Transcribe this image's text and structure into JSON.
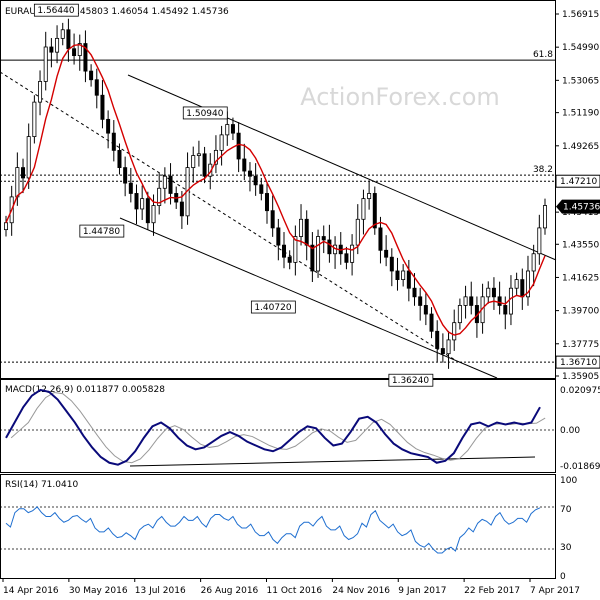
{
  "chart_data": [
    {
      "type": "candlestick",
      "title": "EURAUD,Daily  1.45803 1.46054 1.45492 1.45736",
      "watermark": "ActionForex.com",
      "y_ticks": [
        "1.56915",
        "1.54990",
        "1.53065",
        "1.51190",
        "1.49265",
        "1.47340",
        "1.45415",
        "1.43550",
        "1.41625",
        "1.39700",
        "1.37775",
        "1.35905"
      ],
      "ylim": [
        1.35905,
        1.56915
      ],
      "x_ticks": [
        "14 Apr 2016",
        "30 May 2016",
        "13 Jul 2016",
        "26 Aug 2016",
        "11 Oct 2016",
        "24 Nov 2016",
        "9 Jan 2017",
        "22 Feb 2017",
        "7 Apr 2017"
      ],
      "current_price_label": "1.45736",
      "current_price": 1.45736,
      "levels": [
        {
          "label": "61.8",
          "value": 1.5424
        },
        {
          "label": "38.2",
          "value": 1.4756
        },
        {
          "label": "1.47210",
          "value": 1.4721
        },
        {
          "label": "1.36710",
          "value": 1.3671
        }
      ],
      "annotations": [
        {
          "label": "1.56440",
          "value": 1.5644
        },
        {
          "label": "1.50940",
          "value": 1.5094
        },
        {
          "label": "1.44780",
          "value": 1.4478
        },
        {
          "label": "1.40720",
          "value": 1.4072
        },
        {
          "label": "1.36240",
          "value": 1.3624
        }
      ],
      "close": [
        1.448,
        1.463,
        1.48,
        1.474,
        1.498,
        1.518,
        1.53,
        1.55,
        1.547,
        1.555,
        1.56,
        1.549,
        1.545,
        1.552,
        1.536,
        1.531,
        1.522,
        1.508,
        1.5,
        1.49,
        1.48,
        1.471,
        1.465,
        1.456,
        1.462,
        1.448,
        1.458,
        1.468,
        1.475,
        1.465,
        1.46,
        1.452,
        1.48,
        1.487,
        1.488,
        1.475,
        1.482,
        1.49,
        1.499,
        1.505,
        1.5,
        1.485,
        1.478,
        1.475,
        1.47,
        1.465,
        1.455,
        1.445,
        1.435,
        1.428,
        1.425,
        1.44,
        1.45,
        1.435,
        1.42,
        1.44,
        1.438,
        1.43,
        1.435,
        1.43,
        1.425,
        1.435,
        1.45,
        1.462,
        1.465,
        1.445,
        1.432,
        1.428,
        1.42,
        1.415,
        1.42,
        1.41,
        1.405,
        1.4,
        1.395,
        1.385,
        1.375,
        1.372,
        1.38,
        1.39,
        1.4,
        1.405,
        1.4,
        1.39,
        1.405,
        1.41,
        1.405,
        1.4,
        1.395,
        1.41,
        1.415,
        1.405,
        1.42,
        1.43,
        1.445,
        1.458
      ],
      "sma_label": "moving average (red line)",
      "macd": {
        "label": "MACD(12,26,9) 0.011877 0.005828",
        "ticks": [
          "0.020975",
          "0.00",
          "-0.018693"
        ],
        "ylim": [
          -0.018693,
          0.020975
        ],
        "main": [
          -0.004,
          0.004,
          0.012,
          0.018,
          0.021,
          0.02,
          0.016,
          0.01,
          0.004,
          -0.003,
          -0.009,
          -0.014,
          -0.017,
          -0.018,
          -0.016,
          -0.011,
          -0.004,
          0.002,
          0.004,
          0.001,
          -0.004,
          -0.008,
          -0.01,
          -0.009,
          -0.006,
          -0.003,
          -0.001,
          -0.003,
          -0.006,
          -0.008,
          -0.01,
          -0.011,
          -0.009,
          -0.005,
          -0.001,
          0.002,
          0.001,
          -0.004,
          -0.008,
          -0.007,
          -0.001,
          0.006,
          0.007,
          0.004,
          -0.002,
          -0.007,
          -0.01,
          -0.012,
          -0.013,
          -0.014,
          -0.017,
          -0.016,
          -0.012,
          -0.004,
          0.003,
          0.004,
          0.002,
          0.004,
          0.003,
          0.004,
          0.003,
          0.004,
          0.012
        ]
      },
      "rsi": {
        "label": "RSI(14) 71.0410",
        "ticks": [
          "100",
          "70",
          "30",
          "0"
        ],
        "ylim": [
          0,
          100
        ],
        "values": [
          55,
          66,
          70,
          68,
          66,
          62,
          60,
          58,
          63,
          56,
          50,
          46,
          44,
          41,
          42,
          48,
          54,
          58,
          56,
          52,
          62,
          58,
          55,
          60,
          64,
          58,
          54,
          50,
          46,
          42,
          38,
          40,
          44,
          52,
          56,
          58,
          52,
          48,
          42,
          40,
          55,
          64,
          58,
          50,
          46,
          44,
          36,
          30,
          28,
          24,
          30,
          40,
          50,
          55,
          57,
          62,
          58,
          56,
          60,
          65,
          71
        ]
      }
    }
  ]
}
